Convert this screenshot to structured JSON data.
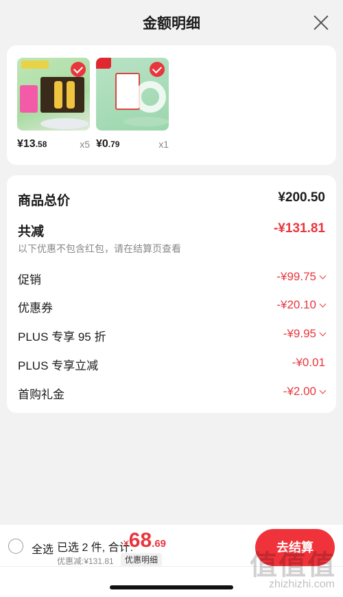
{
  "header": {
    "title": "金额明细"
  },
  "products": [
    {
      "price_int": "¥13",
      "price_dec": ".58",
      "qty": "x5"
    },
    {
      "price_int": "¥0",
      "price_dec": ".79",
      "qty": "x1"
    }
  ],
  "summary": {
    "total_label": "商品总价",
    "total_value": "¥200.50",
    "reduce_label": "共减",
    "reduce_value": "-¥131.81",
    "note": "以下优惠不包含红包，请在结算页查看",
    "items": [
      {
        "label": "促销",
        "value": "-¥99.75"
      },
      {
        "label": "优惠券",
        "value": "-¥20.10"
      },
      {
        "label": "PLUS 专享 95 折",
        "value": "-¥9.95"
      },
      {
        "label": "PLUS 专享立减",
        "value": "-¥0.01"
      },
      {
        "label": "首购礼金",
        "value": "-¥2.00"
      }
    ]
  },
  "bottom": {
    "select_all": "全选",
    "selected": "已选 2 件, 合计:",
    "currency": "¥",
    "total_int": "68",
    "total_dec": ".69",
    "saved": "优惠减:¥131.81",
    "detail": "优惠明细",
    "checkout": "去结算"
  },
  "watermark": {
    "text": "值值值",
    "url": "zhizhizhi.com"
  },
  "colors": {
    "accent": "#e8363d",
    "checkout_bg": "#f0333b"
  },
  "icons": {
    "close": "close-icon",
    "check": "check-icon",
    "chevron": "chevron-down-icon"
  }
}
